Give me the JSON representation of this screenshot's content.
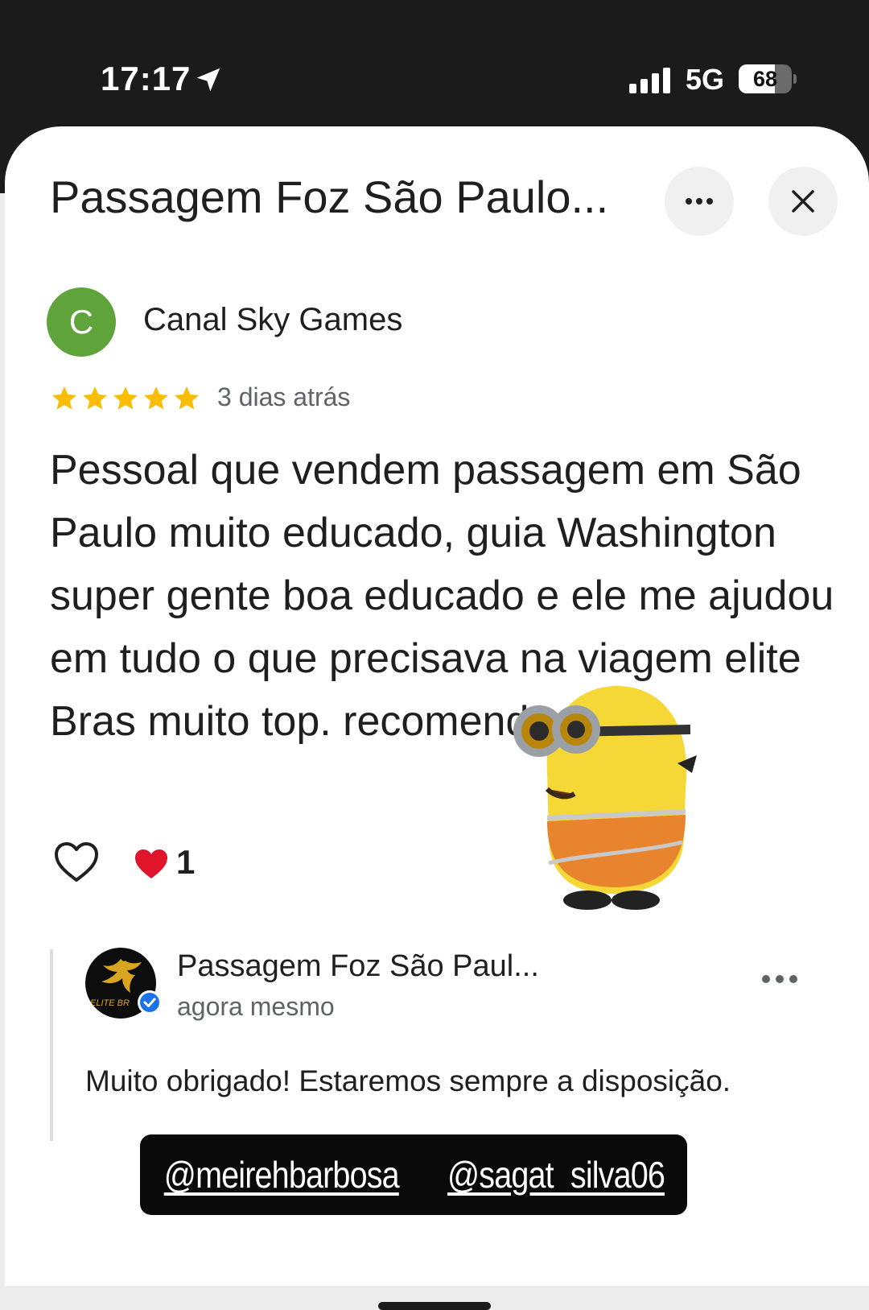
{
  "status_bar": {
    "time": "17:17",
    "network": "5G",
    "battery": "68",
    "battery_level": 0.68,
    "icons": [
      "location-arrow-icon",
      "signal-bars-icon",
      "battery-icon"
    ]
  },
  "sheet": {
    "title": "Passagem Foz São Paulo...",
    "more_icon": "more-horizontal-icon",
    "close_icon": "close-icon"
  },
  "review": {
    "avatar_letter": "C",
    "avatar_color": "#5fa43a",
    "reviewer": "Canal Sky Games",
    "rating": 5,
    "rating_max": 5,
    "star_color": "#fbbc04",
    "time": "3 dias atrás",
    "text": "Pessoal que vendem passagem em São Paulo muito educado, guia Washington super gente boa educado e ele me ajudou em tudo o que precisava na viagem elite Bras muito top. recomendo",
    "reaction_count": "1",
    "icons": [
      "heart-outline-icon",
      "red-heart-icon"
    ]
  },
  "reply": {
    "owner_name": "Passagem Foz São Paul...",
    "time": "agora mesmo",
    "text": "Muito obrigado! Estaremos sempre a disposição.",
    "verified_color": "#1a73e8",
    "logo_text": "ELITE BR"
  },
  "overlay": {
    "mention_1": "@meirehbarbosa",
    "mention_2": "@sagat_silva06",
    "sticker": "minion-sticker"
  }
}
